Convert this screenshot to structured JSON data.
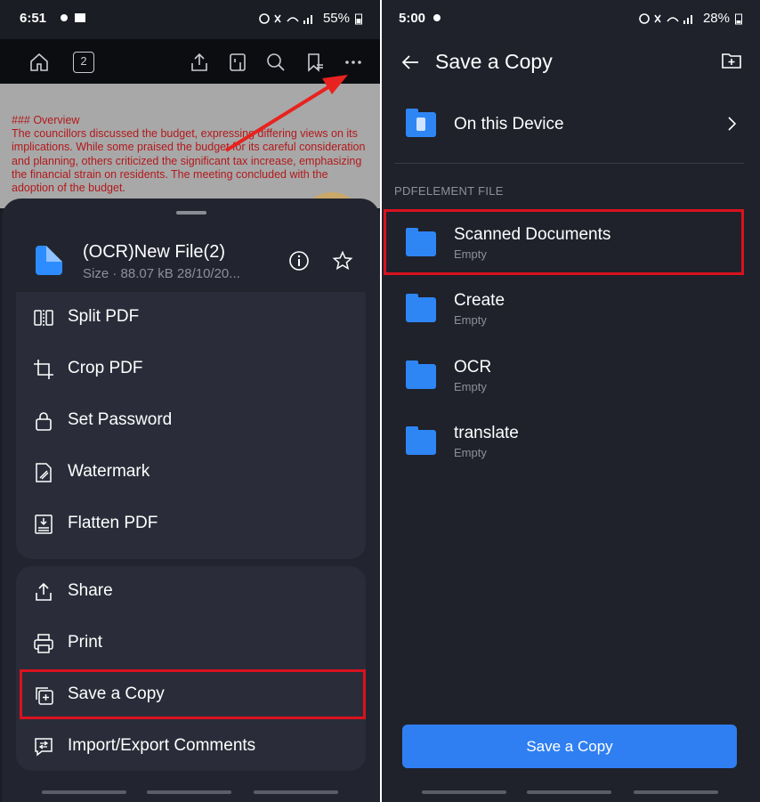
{
  "left": {
    "status": {
      "time": "6:51",
      "battery": "55%"
    },
    "toolbar": {
      "page_badge": "2",
      "icons": [
        "home-icon",
        "page-count-icon",
        "share-icon",
        "page-layout-icon",
        "search-icon",
        "bookmark-icon",
        "more-icon"
      ]
    },
    "doc": {
      "heading": "### Overview",
      "body": "The councillors discussed the budget, expressing differing views on its implications. While some praised the budget for its careful consideration and planning, others criticized the significant tax increase, emphasizing the financial strain on residents. The meeting concluded with the adoption of the budget."
    },
    "sheet": {
      "file_name": "(OCR)New File(2)",
      "file_meta": "Size · 88.07 kB 28/10/20...",
      "menu_top": [
        {
          "label": "Split PDF",
          "icon": "split-icon"
        },
        {
          "label": "Crop PDF",
          "icon": "crop-icon"
        },
        {
          "label": "Set Password",
          "icon": "lock-icon"
        },
        {
          "label": "Watermark",
          "icon": "watermark-icon"
        },
        {
          "label": "Flatten PDF",
          "icon": "flatten-icon"
        }
      ],
      "menu_bottom": [
        {
          "label": "Share",
          "icon": "share-icon"
        },
        {
          "label": "Print",
          "icon": "print-icon"
        },
        {
          "label": "Save a Copy",
          "icon": "save-copy-icon"
        },
        {
          "label": "Import/Export Comments",
          "icon": "comments-icon"
        }
      ]
    }
  },
  "right": {
    "status": {
      "time": "5:00",
      "battery": "28%"
    },
    "title": "Save a Copy",
    "device_row": "On this Device",
    "section_label": "PDFELEMENT FILE",
    "folders": [
      {
        "name": "Scanned Documents",
        "sub": "Empty"
      },
      {
        "name": "Create",
        "sub": "Empty"
      },
      {
        "name": "OCR",
        "sub": "Empty"
      },
      {
        "name": "translate",
        "sub": "Empty"
      }
    ],
    "save_button": "Save a Copy"
  },
  "colors": {
    "accent": "#2f7ff2",
    "highlight": "#d9121e",
    "arrow": "#e8231f",
    "folder": "#2e86f5"
  }
}
